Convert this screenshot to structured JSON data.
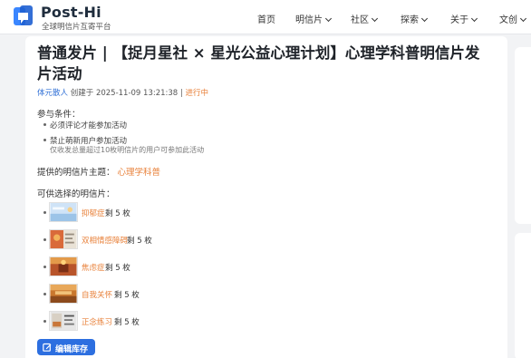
{
  "brand": {
    "name": "Post-Hi",
    "tagline": "全球明信片互寄平台"
  },
  "nav": {
    "items": [
      {
        "label": "首页"
      },
      {
        "label": "明信片"
      },
      {
        "label": "社区"
      },
      {
        "label": "探索"
      },
      {
        "label": "关于"
      },
      {
        "label": "文创"
      }
    ]
  },
  "post": {
    "title": "普通发片 | 【捉月星社 × 星光公益心理计划】心理学科普明信片发片活动",
    "author": "体元散人",
    "created_prefix": "创建于",
    "created_at": "2025-11-09 13:21:38",
    "separator": "|",
    "status": "进行中"
  },
  "conditions": {
    "heading": "参与条件：",
    "items": [
      "必须评论才能参加活动",
      "禁止萌新用户参加活动"
    ],
    "note": "仅收发总量超过10枚明信片的用户可参加此活动"
  },
  "theme": {
    "label": "提供的明信片主题：",
    "value": "心理学科普"
  },
  "postcards": {
    "heading": "可供选择的明信片：",
    "items": [
      {
        "name": "抑郁症",
        "count": "剩 5 枚"
      },
      {
        "name": "双相情感障碍",
        "count": "剩 5 枚"
      },
      {
        "name": "焦虑症",
        "count": "剩 5 枚"
      },
      {
        "name": "自我关怀",
        "count": "剩 5 枚"
      },
      {
        "name": "正念练习",
        "count": "剩 5 枚"
      }
    ]
  },
  "actions": {
    "edit_stock": "编辑库存"
  },
  "colors": {
    "accent": "#2d6fe0",
    "link_orange": "#e8813a",
    "author_blue": "#2f6fd6"
  }
}
